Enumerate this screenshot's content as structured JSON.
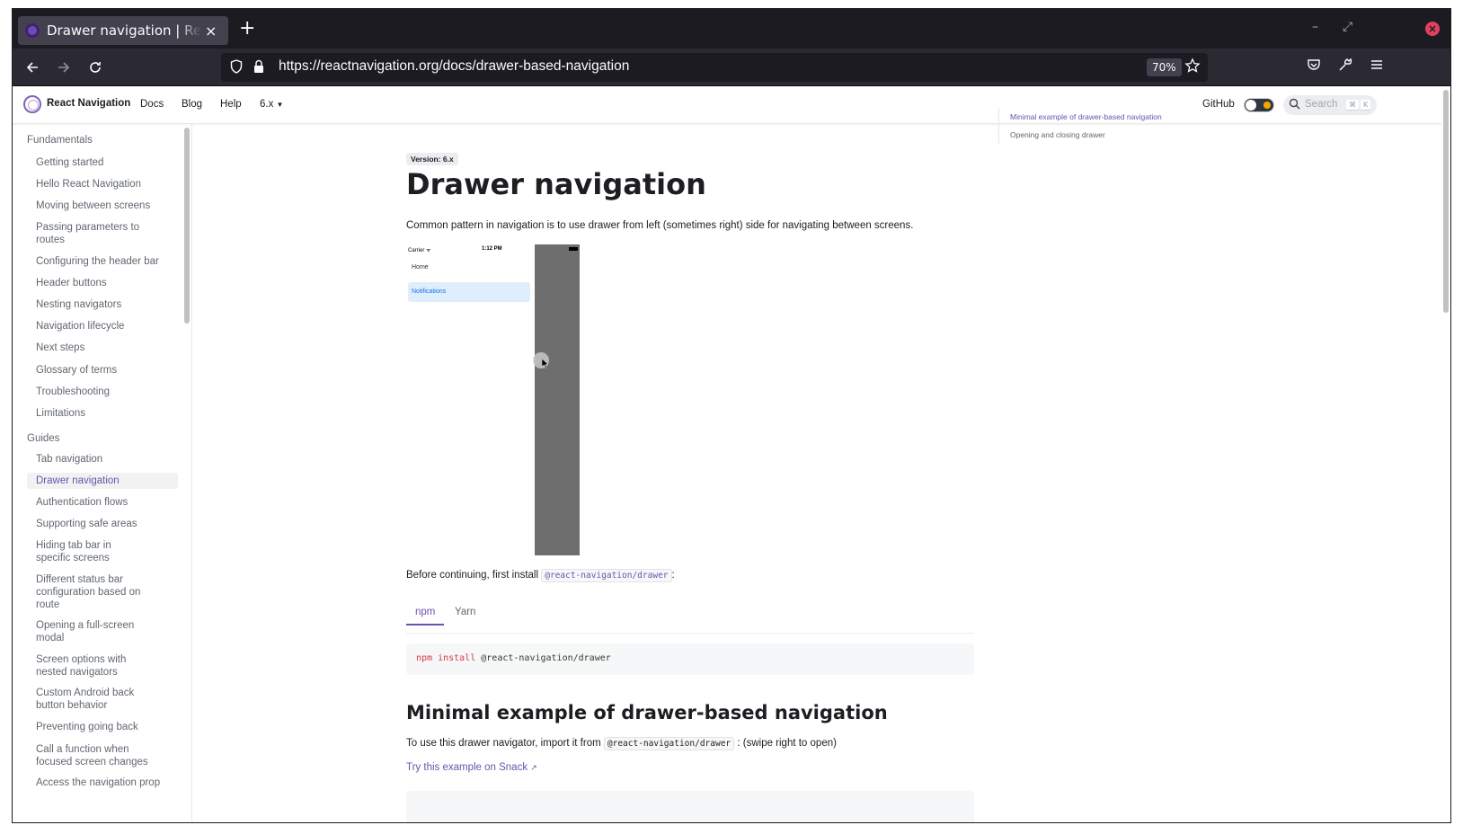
{
  "browser": {
    "tab_title": "Drawer navigation | React Navigation",
    "tab_close": "×",
    "new_tab": "+",
    "url": "https://reactnavigation.org/docs/drawer-based-navigation",
    "zoom": "70%",
    "window_controls": {
      "minimize": "–",
      "restore": "⤢",
      "close": "×"
    }
  },
  "site_nav": {
    "brand": "React Navigation",
    "links": [
      "Docs",
      "Blog",
      "Help"
    ],
    "version_dropdown": "6.x",
    "github": "GitHub",
    "search_placeholder": "Search",
    "search_keys": [
      "⌘",
      "K"
    ]
  },
  "sidebar": {
    "categories": [
      "Fundamentals",
      "Guides"
    ],
    "fundamentals": [
      "Getting started",
      "Hello React Navigation",
      "Moving between screens",
      "Passing parameters to routes",
      "Configuring the header bar",
      "Header buttons",
      "Nesting navigators",
      "Navigation lifecycle",
      "Next steps",
      "Glossary of terms",
      "Troubleshooting",
      "Limitations"
    ],
    "guides": [
      "Tab navigation",
      "Drawer navigation",
      "Authentication flows",
      "Supporting safe areas",
      "Hiding tab bar in specific screens",
      "Different status bar configuration based on route",
      "Opening a full-screen modal",
      "Screen options with nested navigators",
      "Custom Android back button behavior",
      "Preventing going back",
      "Call a function when focused screen changes",
      "Access the navigation prop"
    ],
    "active": "Drawer navigation"
  },
  "main": {
    "version_badge": "Version: 6.x",
    "title": "Drawer navigation",
    "intro": "Common pattern in navigation is to use drawer from left (sometimes right) side for navigating between screens.",
    "demo": {
      "carrier": "Carrier ᯤ",
      "time": "1:12 PM",
      "home": "Home",
      "notifications": "Notifications"
    },
    "install_prefix": "Before continuing, first install",
    "install_package": "@react-navigation/drawer",
    "install_suffix": ":",
    "tabs": [
      "npm",
      "Yarn"
    ],
    "code_keyword": "npm install",
    "code_arg": "@react-navigation/drawer",
    "section_title": "Minimal example of drawer-based navigation",
    "usage_prefix": "To use this drawer navigator, import it from",
    "usage_package": "@react-navigation/drawer",
    "usage_suffix": ": (swipe right to open)",
    "snack_link": "Try this example on Snack",
    "snack_icon": "↗"
  },
  "toc": {
    "items": [
      "Minimal example of drawer-based navigation",
      "Opening and closing drawer"
    ],
    "active_index": 0
  },
  "colors": {
    "accent": "#6b52ae",
    "browser_chrome": "#1c1b22",
    "toolbar": "#2b2a33"
  }
}
